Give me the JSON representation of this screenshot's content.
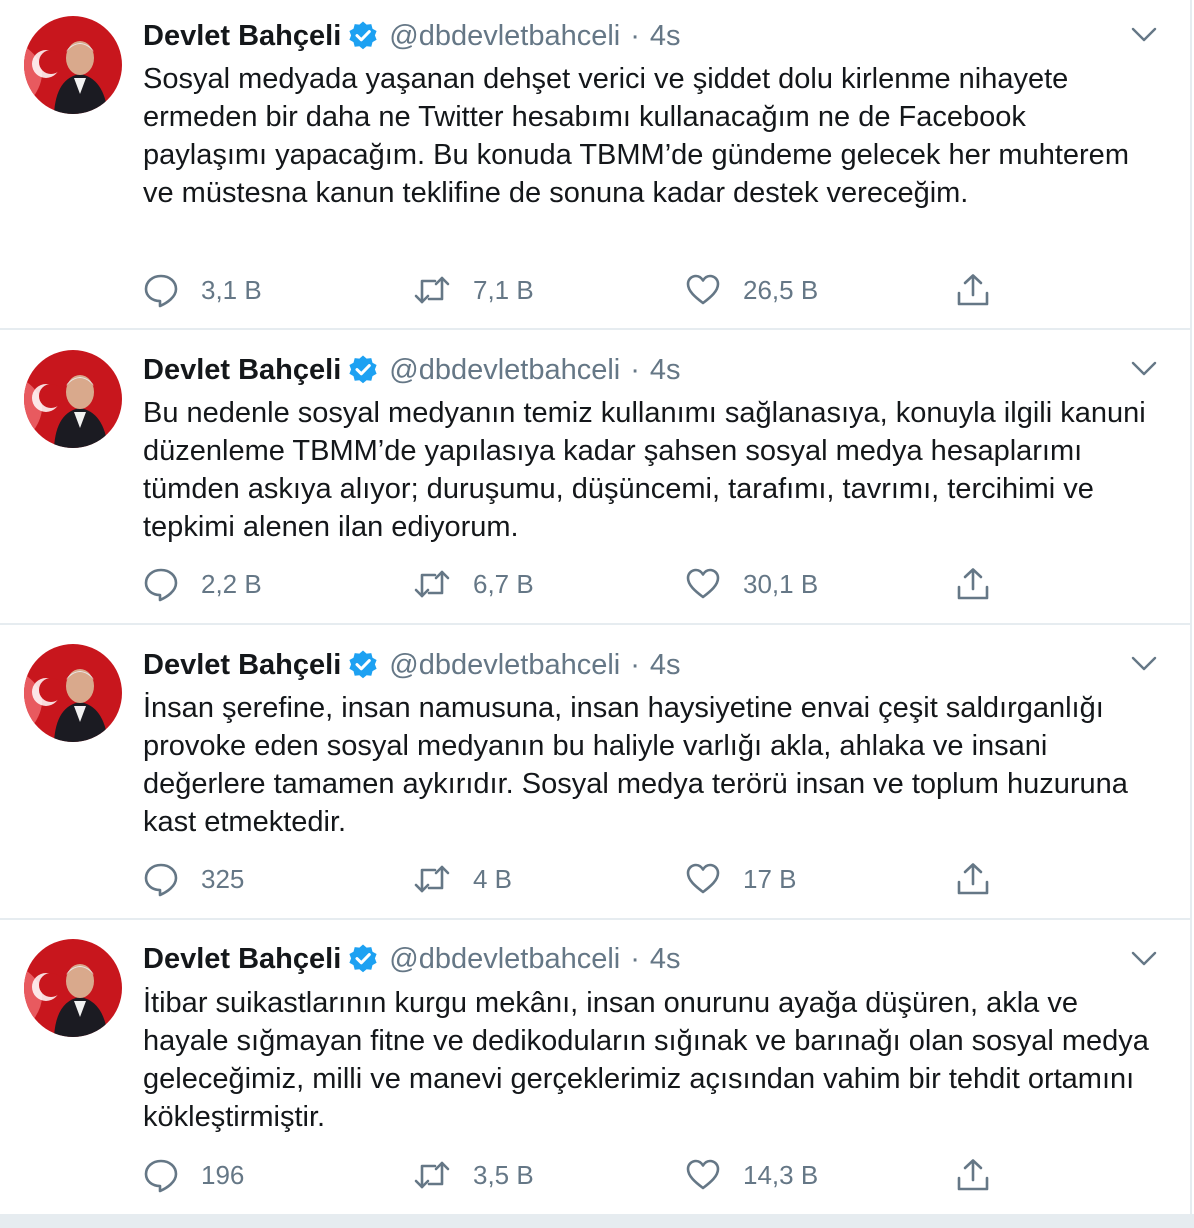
{
  "tweets": [
    {
      "name": "Devlet Bahçeli",
      "handle": "@dbdevletbahceli",
      "separator": "·",
      "time": "4s",
      "text": "Sosyal medyada yaşanan dehşet verici ve şiddet dolu kirlenme nihayete ermeden bir daha ne Twitter hesabımı kullanacağım ne de Facebook paylaşımı yapacağım. Bu konuda TBMM’de gündeme gelecek her muhterem ve müstesna kanun teklifine de sonuna kadar destek vereceğim.",
      "replies": "3,1 B",
      "retweets": "7,1 B",
      "likes": "26,5 B"
    },
    {
      "name": "Devlet Bahçeli",
      "handle": "@dbdevletbahceli",
      "separator": "·",
      "time": "4s",
      "text": "Bu nedenle sosyal medyanın temiz kullanımı sağlanasıya, konuyla ilgili kanuni düzenleme TBMM’de yapılasıya kadar şahsen sosyal medya hesaplarımı tümden askıya alıyor; duruşumu, düşüncemi, tarafımı, tavrımı, tercihimi ve tepkimi alenen ilan ediyorum.",
      "replies": "2,2 B",
      "retweets": "6,7 B",
      "likes": "30,1 B"
    },
    {
      "name": "Devlet Bahçeli",
      "handle": "@dbdevletbahceli",
      "separator": "·",
      "time": "4s",
      "text": "İnsan şerefine, insan namusuna, insan haysiyetine envai çeşit saldırganlığı provoke eden sosyal medyanın bu haliyle varlığı akla, ahlaka ve insani değerlere tamamen aykırıdır. Sosyal medya terörü insan ve toplum huzuruna kast etmektedir.",
      "replies": "325",
      "retweets": "4 B",
      "likes": "17 B"
    },
    {
      "name": "Devlet Bahçeli",
      "handle": "@dbdevletbahceli",
      "separator": "·",
      "time": "4s",
      "text": "İtibar suikastlarının kurgu mekânı, insan onurunu ayağa düşüren, akla ve hayale sığmayan fitne ve dedikoduların sığınak ve barınağı olan sosyal medya geleceğimiz, milli ve manevi gerçeklerimiz açısından vahim bir tehdit ortamını kökleştirmiştir.",
      "replies": "196",
      "retweets": "3,5 B",
      "likes": "14,3 B"
    }
  ],
  "colors": {
    "text": "#14171a",
    "secondary": "#657786",
    "verified": "#1da1f2",
    "divider": "#e6ecf0"
  },
  "icons": {
    "reply": "speech-bubble-icon",
    "retweet": "retweet-arrows-icon",
    "like": "heart-icon",
    "share": "share-upload-icon",
    "verified": "verified-badge-icon",
    "menu": "chevron-down-icon"
  }
}
